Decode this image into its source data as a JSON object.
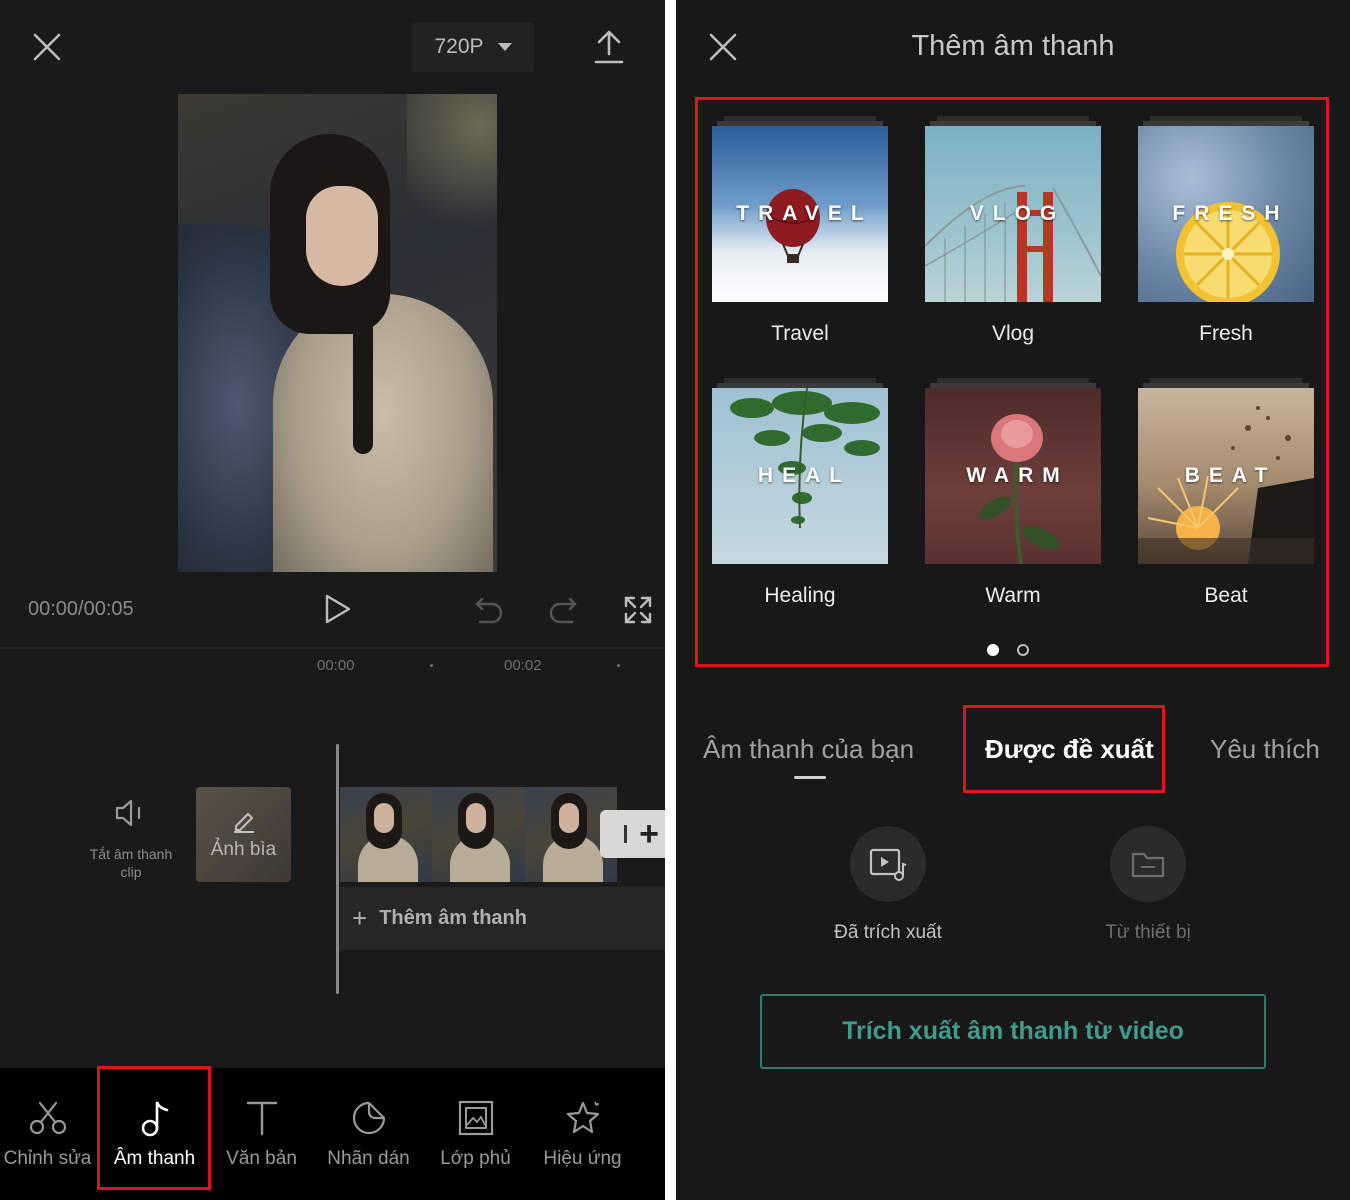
{
  "editor": {
    "resolution": "720P",
    "timecode": "00:00/00:05",
    "timeline_marks": [
      "00:00",
      "00:02"
    ],
    "mute_label": "Tắt âm thanh clip",
    "cover_label": "Ảnh bìa",
    "add_audio_label": "Thêm âm thanh",
    "toolbar": [
      {
        "label": "Chỉnh sửa",
        "icon": "scissors-icon"
      },
      {
        "label": "Âm thanh",
        "icon": "music-note-icon",
        "active": true
      },
      {
        "label": "Văn bản",
        "icon": "text-icon"
      },
      {
        "label": "Nhãn dán",
        "icon": "sticker-icon"
      },
      {
        "label": "Lớp phủ",
        "icon": "overlay-icon"
      },
      {
        "label": "Hiệu ứng",
        "icon": "effects-star-icon"
      }
    ]
  },
  "sound_picker": {
    "title": "Thêm âm thanh",
    "categories": [
      {
        "word": "TRAVEL",
        "label": "Travel"
      },
      {
        "word": "VLOG",
        "label": "Vlog"
      },
      {
        "word": "FRESH",
        "label": "Fresh"
      },
      {
        "word": "HEAL",
        "label": "Healing"
      },
      {
        "word": "WARM",
        "label": "Warm"
      },
      {
        "word": "BEAT",
        "label": "Beat"
      }
    ],
    "page_indicator": {
      "current": 1,
      "total": 2
    },
    "tabs": [
      "Âm thanh của bạn",
      "Được đề xuất",
      "Yêu thích"
    ],
    "active_tab": "Âm thanh của bạn",
    "sources": [
      {
        "label": "Đã trích xuất",
        "icon": "video-music-icon"
      },
      {
        "label": "Từ thiết bị",
        "icon": "folder-icon"
      }
    ],
    "extract_button": "Trích xuất âm thanh từ video"
  },
  "colors": {
    "background": "#1a1a1a",
    "highlight_red": "#e0141e",
    "accent_teal": "#3f9b8d"
  }
}
